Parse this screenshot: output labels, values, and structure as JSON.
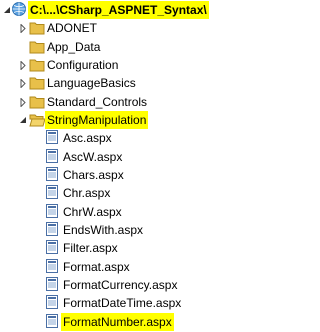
{
  "root": {
    "label": "C:\\...\\CSharp_ASPNET_Syntax\\",
    "highlighted": true
  },
  "folders_top": [
    {
      "label": "ADONET"
    },
    {
      "label": "App_Data"
    },
    {
      "label": "Configuration"
    },
    {
      "label": "LanguageBasics"
    },
    {
      "label": "Standard_Controls"
    }
  ],
  "open_folder": {
    "label": "StringManipulation",
    "highlighted": true
  },
  "files": [
    {
      "label": "Asc.aspx"
    },
    {
      "label": "AscW.aspx"
    },
    {
      "label": "Chars.aspx"
    },
    {
      "label": "Chr.aspx"
    },
    {
      "label": "ChrW.aspx"
    },
    {
      "label": "EndsWith.aspx"
    },
    {
      "label": "Filter.aspx"
    },
    {
      "label": "Format.aspx"
    },
    {
      "label": "FormatCurrency.aspx"
    },
    {
      "label": "FormatDateTime.aspx"
    },
    {
      "label": "FormatNumber.aspx",
      "highlighted": true
    }
  ],
  "colors": {
    "highlight": "#ffff00",
    "folder": "#e8c04a",
    "text": "#000000"
  },
  "icons": {
    "root": "web-project-icon",
    "folder": "folder-icon",
    "file": "aspx-file-icon"
  }
}
